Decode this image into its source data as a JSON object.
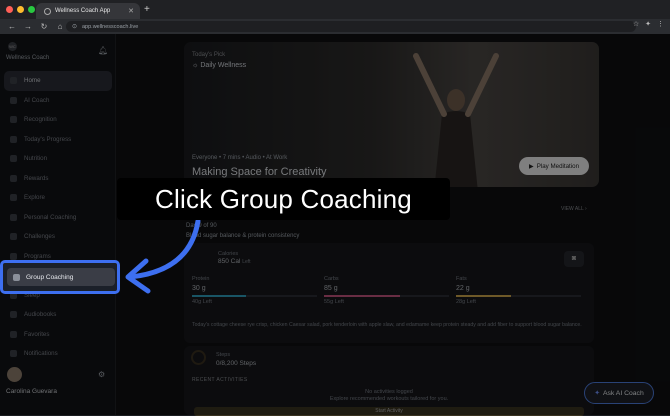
{
  "browser": {
    "tab_title": "Wellness Coach App",
    "url": "app.wellnesscoach.live"
  },
  "sidebar": {
    "brand": "Wellness Coach",
    "items": [
      {
        "label": "Home",
        "active": true
      },
      {
        "label": "AI Coach"
      },
      {
        "label": "Recognition"
      },
      {
        "label": "Today's Progress"
      },
      {
        "label": "Nutrition"
      },
      {
        "label": "Rewards"
      },
      {
        "label": "Explore"
      },
      {
        "label": "Personal Coaching"
      },
      {
        "label": "Challenges"
      },
      {
        "label": "Programs"
      },
      {
        "label": "Group Coaching"
      },
      {
        "label": "Sleep"
      },
      {
        "label": "Audiobooks"
      },
      {
        "label": "Favorites"
      },
      {
        "label": "Notifications"
      }
    ],
    "user_name": "Carolina Guevara"
  },
  "hero": {
    "kicker": "Today's Pick",
    "category": "Daily Wellness",
    "meta": "Everyone  •  7 mins  •  Audio  •  At Work",
    "title": "Making Space for Creativity",
    "play_label": "Play Meditation"
  },
  "view_all": "VIEW ALL",
  "plan": {
    "day": "Day 9 of 90",
    "goal": "Blood sugar balance & protein consistency"
  },
  "nutrition": {
    "calories_label": "Calories",
    "calories_value": "850 Cal",
    "calories_left": "Left",
    "macros": [
      {
        "name": "Protein",
        "value": "30 g",
        "left": "40g Left",
        "color": "#2e9cb8",
        "fill": 0.43
      },
      {
        "name": "Carbs",
        "value": "85 g",
        "left": "55g Left",
        "color": "#c0527a",
        "fill": 0.61
      },
      {
        "name": "Fats",
        "value": "22 g",
        "left": "28g Left",
        "color": "#c9a24a",
        "fill": 0.44
      }
    ],
    "description": "Today's cottage cheese rye crisp, chicken Caesar salad, pork tenderloin with apple slaw, and edamame keep protein steady and add fiber to support blood sugar balance."
  },
  "steps": {
    "label": "Steps",
    "value": "0/8,200 Steps"
  },
  "activities": {
    "header": "RECENT ACTIVITIES",
    "empty": "No activities logged",
    "hint": "Explore recommended workouts tailored for you.",
    "button": "Start Activity"
  },
  "ask_ai": "Ask AI Coach",
  "tutorial": {
    "callout": "Click Group Coaching",
    "highlight_label": "Group Coaching"
  }
}
